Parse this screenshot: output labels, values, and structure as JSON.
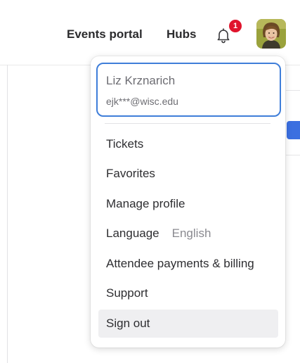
{
  "header": {
    "nav": [
      {
        "label": "Events portal"
      },
      {
        "label": "Hubs"
      }
    ],
    "notifications": {
      "count": "1",
      "icon": "bell-icon"
    },
    "avatar": {
      "icon": "user-avatar"
    }
  },
  "dropdown": {
    "user": {
      "name": "Liz Krznarich",
      "email": "ejk***@wisc.edu"
    },
    "items": [
      {
        "label": "Tickets"
      },
      {
        "label": "Favorites"
      },
      {
        "label": "Manage profile"
      },
      {
        "label": "Language",
        "value": "English"
      },
      {
        "label": "Attendee payments & billing"
      },
      {
        "label": "Support"
      },
      {
        "label": "Sign out"
      }
    ],
    "accent_color": "#3f7ed9",
    "badge_color": "#e0142c"
  }
}
